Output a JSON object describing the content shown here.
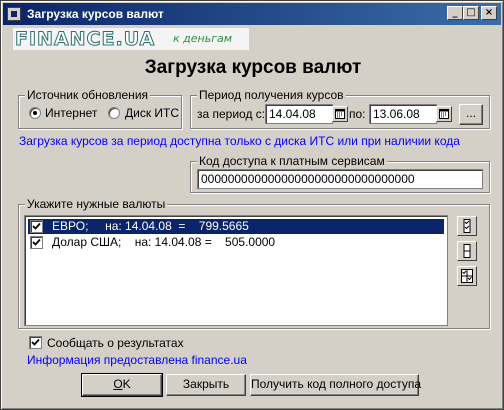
{
  "window": {
    "title": "Загрузка курсов валют",
    "minimize_glyph": "_",
    "maximize_glyph": "□",
    "close_glyph": "×"
  },
  "logo": {
    "main": "FINANCE.UA",
    "sub": "к деньгам"
  },
  "heading": "Загрузка курсов валют",
  "source_group": {
    "label": "Источник обновления",
    "options": [
      {
        "label": "Интернет",
        "selected": true
      },
      {
        "label": "Диск ИТС",
        "selected": false
      }
    ]
  },
  "period_group": {
    "label": "Период получения курсов",
    "from_label": "за период  с:",
    "from_value": "14.04.08",
    "to_label": "по:",
    "to_value": "13.06.08",
    "more_button": "..."
  },
  "notice": "Загрузка курсов за период доступна только с диска ИТС или при наличии кода",
  "access_group": {
    "label": "Код доступа к платным сервисам",
    "value": "00000000000000000000000000000000"
  },
  "currency_group": {
    "label": "Укажите нужные валюты",
    "items": [
      {
        "text": "ЕВРО;     на: 14.04.08  =    799.5665",
        "checked": true,
        "selected": true
      },
      {
        "text": "Долар США;    на: 14.04.08 =    505.0000",
        "checked": true,
        "selected": false
      }
    ]
  },
  "report_checkbox": {
    "label": "Сообщать о результатах",
    "checked": true
  },
  "info_text": "Информация предоставлена finance.ua",
  "buttons": {
    "ok_mnemonic": "O",
    "ok_rest": "K",
    "close": "Закрыть",
    "full_access": "Получить код полного доступа"
  },
  "colors": {
    "titlebar": "#0a246a",
    "selection": "#0a246a",
    "link_text": "#0000ff",
    "logo_accent": "#2f8f3f"
  }
}
